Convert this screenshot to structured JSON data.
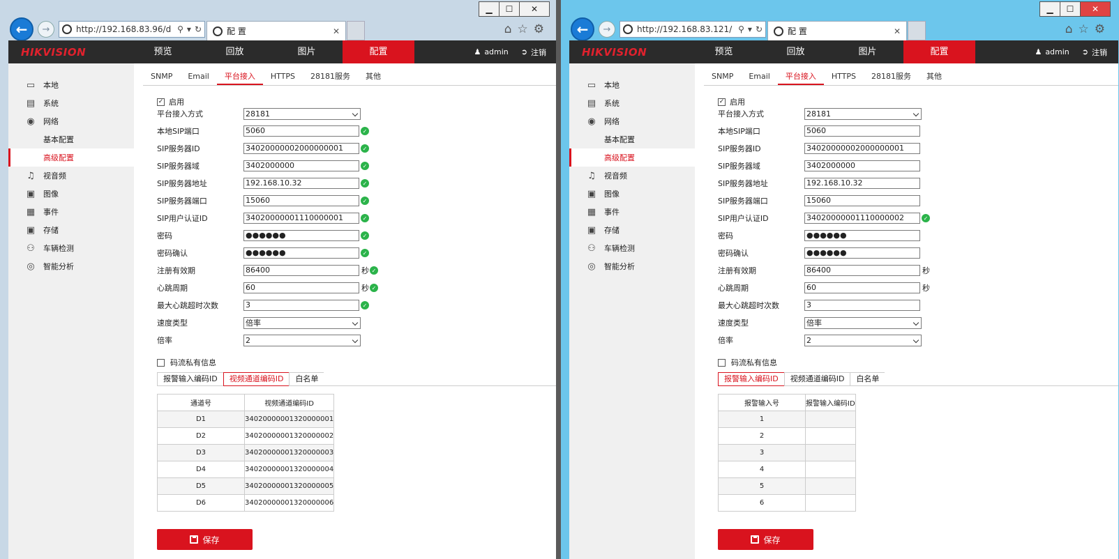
{
  "caption": {
    "minimize": "▁",
    "maximize": "☐",
    "close": "✕"
  },
  "nav": {
    "logo": "HIKVISION",
    "items": [
      "预览",
      "回放",
      "图片",
      "配置"
    ],
    "user": "admin",
    "logout": "注销"
  },
  "sidebar": [
    "本地",
    "系统",
    "网络",
    "基本配置",
    "高级配置",
    "视音频",
    "图像",
    "事件",
    "存储",
    "车辆检测",
    "智能分析"
  ],
  "subtabs": [
    "SNMP",
    "Email",
    "平台接入",
    "HTTPS",
    "28181服务",
    "其他"
  ],
  "form": {
    "enable": "启用",
    "labels": [
      "平台接入方式",
      "本地SIP端口",
      "SIP服务器ID",
      "SIP服务器域",
      "SIP服务器地址",
      "SIP服务器端口",
      "SIP用户认证ID",
      "密码",
      "密码确认",
      "注册有效期",
      "心跳周期",
      "最大心跳超时次数",
      "速度类型",
      "倍率"
    ],
    "unit_seconds": "秒",
    "private_info": "码流私有信息"
  },
  "steps": [
    "报警输入编码ID",
    "视频通道编码ID",
    "白名单"
  ],
  "save": "保存",
  "windows": {
    "left": {
      "url": "http://192.168.83.96/d",
      "tab_title": "配 置",
      "values": [
        "28181",
        "5060",
        "34020000002000000001",
        "3402000000",
        "192.168.10.32",
        "15060",
        "34020000001110000001",
        "●●●●●●",
        "●●●●●●",
        "86400",
        "60",
        "3",
        "倍率",
        "2"
      ],
      "table": {
        "headers": [
          "通道号",
          "视频通道编码ID"
        ],
        "rows": [
          [
            "D1",
            "34020000001320000001"
          ],
          [
            "D2",
            "34020000001320000002"
          ],
          [
            "D3",
            "34020000001320000003"
          ],
          [
            "D4",
            "34020000001320000004"
          ],
          [
            "D5",
            "34020000001320000005"
          ],
          [
            "D6",
            "34020000001320000006"
          ]
        ]
      }
    },
    "right": {
      "url": "http://192.168.83.121/",
      "tab_title": "配 置",
      "values": [
        "28181",
        "5060",
        "34020000002000000001",
        "3402000000",
        "192.168.10.32",
        "15060",
        "34020000001110000002",
        "●●●●●●",
        "●●●●●●",
        "86400",
        "60",
        "3",
        "倍率",
        "2"
      ],
      "table": {
        "headers": [
          "报警输入号",
          "报警输入编码ID"
        ],
        "rows": [
          [
            "1",
            ""
          ],
          [
            "2",
            ""
          ],
          [
            "3",
            ""
          ],
          [
            "4",
            ""
          ],
          [
            "5",
            ""
          ],
          [
            "6",
            ""
          ]
        ]
      }
    }
  }
}
